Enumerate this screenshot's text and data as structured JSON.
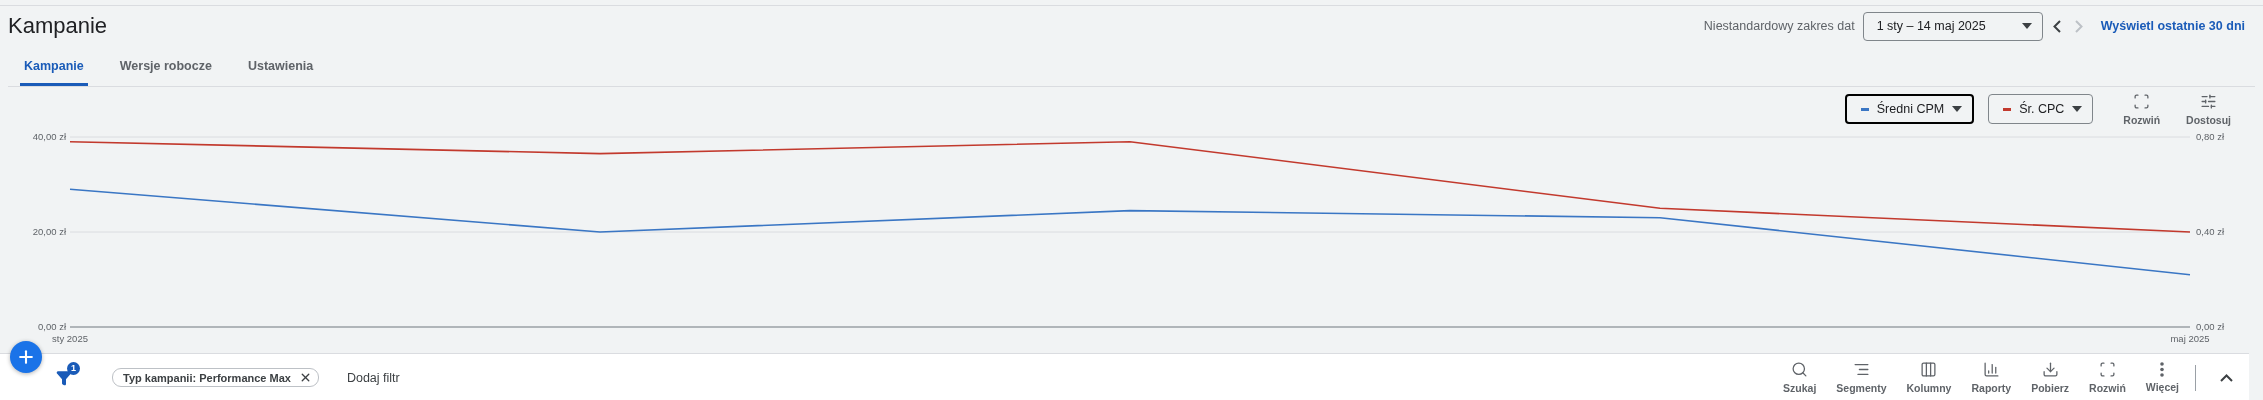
{
  "header": {
    "title": "Kampanie",
    "date_range_label": "Niestandardowy zakres dat",
    "date_range": "1 sty – 14 maj 2025",
    "last_30_link": "Wyświetl ostatnie 30 dni"
  },
  "tabs": [
    {
      "label": "Kampanie",
      "selected": true
    },
    {
      "label": "Wersje robocze",
      "selected": false
    },
    {
      "label": "Ustawienia",
      "selected": false
    }
  ],
  "chart": {
    "legend": [
      {
        "selected": true
      },
      {
        "selected": false
      }
    ],
    "tools": [
      {
        "label": "Rozwiń",
        "kind": "expand"
      },
      {
        "label": "Dostosuj",
        "kind": "adjust"
      }
    ],
    "chart_data": {
      "type": "line",
      "categories": [
        "sty 2025",
        null,
        null,
        null,
        "maj 2025"
      ],
      "ylim": [
        0,
        40
      ],
      "yticks": [
        {
          "value": 0,
          "label": "0,00 zł"
        },
        {
          "value": 20,
          "label": "20,00 zł"
        },
        {
          "value": 40,
          "label": "40,00 zł"
        }
      ],
      "y2lim": [
        0,
        0.8
      ],
      "y2ticks": [
        {
          "value": 0,
          "label": "0,00 zł"
        },
        {
          "value": 0.4,
          "label": "0,40 zł"
        },
        {
          "value": 0.8,
          "label": "0,80 zł"
        }
      ],
      "series": [
        {
          "name": "Średni CPM",
          "color": "#3a76c4",
          "values": [
            29,
            20,
            24.5,
            23,
            11
          ]
        },
        {
          "name": "Śr. CPC",
          "color": "#c2392d",
          "axis": "y2",
          "values": [
            0.78,
            0.73,
            0.78,
            0.5,
            0.4
          ]
        }
      ]
    }
  },
  "filter_bar": {
    "filter_count": "1",
    "chips": [
      "Typ kampanii: Performance Max"
    ],
    "add_filter": "Dodaj filtr",
    "tools": [
      {
        "label": "Szukaj",
        "kind": "search"
      },
      {
        "label": "Segmenty",
        "kind": "segments"
      },
      {
        "label": "Kolumny",
        "kind": "columns"
      },
      {
        "label": "Raporty",
        "kind": "reports"
      },
      {
        "label": "Pobierz",
        "kind": "download"
      },
      {
        "label": "Rozwiń",
        "kind": "expand"
      },
      {
        "label": "Więcej",
        "kind": "more"
      }
    ]
  }
}
